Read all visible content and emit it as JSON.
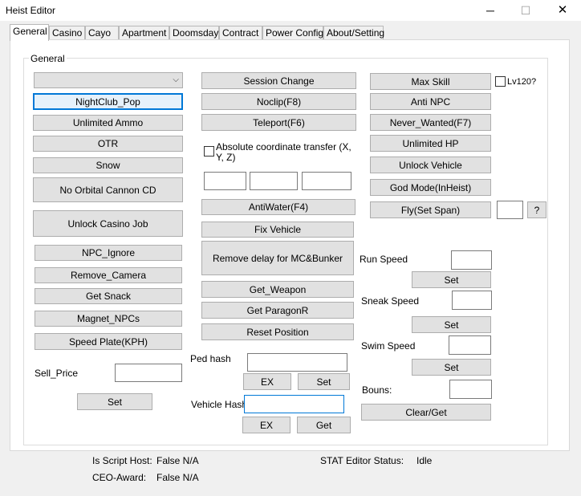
{
  "window": {
    "title": "Heist Editor",
    "minimize": "─",
    "maximize": "☐",
    "close": "✕"
  },
  "tabs": [
    "General",
    "Casino",
    "Cayo",
    "Apartment",
    "Doomsday",
    "Contract",
    "Power Config",
    "About/Setting"
  ],
  "group_label": "General",
  "col1": {
    "combo_value": "",
    "nightclub_pop": "NightClub_Pop",
    "unlimited_ammo": "Unlimited Ammo",
    "otr": "OTR",
    "snow": "Snow",
    "no_orbital": "No Orbital Cannon CD",
    "unlock_casino": "Unlock Casino Job",
    "npc_ignore": "NPC_Ignore",
    "remove_camera": "Remove_Camera",
    "get_snack": "Get Snack",
    "magnet_npcs": "Magnet_NPCs",
    "speed_plate": "Speed Plate(KPH)",
    "sell_price_label": "Sell_Price",
    "sell_price_value": "",
    "set": "Set"
  },
  "col2": {
    "session_change": "Session Change",
    "noclip": "Noclip(F8)",
    "teleport": "Teleport(F6)",
    "abs_coord": "Absolute coordinate transfer (X, Y, Z)",
    "coord_x": "",
    "coord_y": "",
    "coord_z": "",
    "antiwater": "AntiWater(F4)",
    "fix_vehicle": "Fix Vehicle",
    "remove_delay": "Remove delay for MC&Bunker",
    "get_weapon": "Get_Weapon",
    "get_paragonr": "Get ParagonR",
    "reset_position": "Reset Position",
    "ped_hash_label": "Ped hash",
    "ped_hash_value": "",
    "ex1": "EX",
    "set1": "Set",
    "vehicle_hash_label": "Vehicle Hash",
    "vehicle_hash_value": "",
    "ex2": "EX",
    "get2": "Get"
  },
  "col3": {
    "max_skill": "Max Skill",
    "lv120": "Lv120?",
    "anti_npc": "Anti NPC",
    "never_wanted": "Never_Wanted(F7)",
    "unlimited_hp": "Unlimited HP",
    "unlock_vehicle": "Unlock Vehicle",
    "god_mode": "God Mode(InHeist)",
    "fly": "Fly(Set Span)",
    "fly_value": "",
    "help": "?",
    "run_speed_label": "Run Speed",
    "run_speed_value": "",
    "run_set": "Set",
    "sneak_speed_label": "Sneak Speed",
    "sneak_speed_value": "",
    "sneak_set": "Set",
    "swim_speed_label": "Swim Speed",
    "swim_speed_value": "",
    "swim_set": "Set",
    "bouns_label": "Bouns:",
    "bouns_value": "",
    "clear_get": "Clear/Get"
  },
  "status": {
    "script_host_label": "Is Script Host:",
    "script_host_value": "False N/A",
    "ceo_award_label": "CEO-Award:",
    "ceo_award_value": "False N/A",
    "stat_editor_label": "STAT Editor Status:",
    "stat_editor_value": "Idle"
  }
}
